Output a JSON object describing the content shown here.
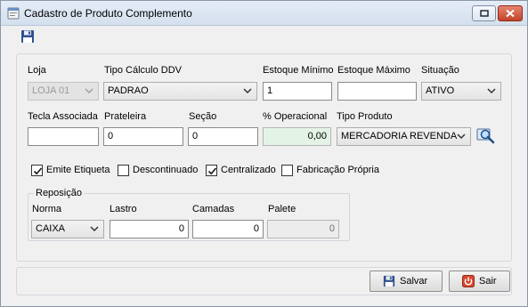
{
  "window": {
    "title": "Cadastro de Produto Complemento",
    "icons": {
      "app": "app-form-icon",
      "restore": "restore-icon",
      "close": "close-icon"
    }
  },
  "toolbar": {
    "save_icon": "floppy-disk-icon"
  },
  "form": {
    "loja": {
      "label": "Loja",
      "value": "LOJA 01"
    },
    "tipo_calculo_ddv": {
      "label": "Tipo Cálculo DDV",
      "value": "PADRAO"
    },
    "estoque_minimo": {
      "label": "Estoque Mínimo",
      "value": "1"
    },
    "estoque_maximo": {
      "label": "Estoque Máximo",
      "value": ""
    },
    "situacao": {
      "label": "Situação",
      "value": "ATIVO"
    },
    "tecla_associada": {
      "label": "Tecla Associada",
      "value": ""
    },
    "prateleira": {
      "label": "Prateleira",
      "value": "0"
    },
    "secao": {
      "label": "Seção",
      "value": "0"
    },
    "percentual_operacional": {
      "label": "% Operacional",
      "value": "0,00"
    },
    "tipo_produto": {
      "label": "Tipo Produto",
      "value": "MERCADORIA REVENDA",
      "search_icon": "search-magnifier-icon"
    }
  },
  "checkboxes": [
    {
      "label": "Emite Etiqueta",
      "checked": true
    },
    {
      "label": "Descontinuado",
      "checked": false
    },
    {
      "label": "Centralizado",
      "checked": true
    },
    {
      "label": "Fabricação Própria",
      "checked": false
    }
  ],
  "reposicao": {
    "title": "Reposição",
    "norma": {
      "label": "Norma",
      "value": "CAIXA"
    },
    "lastro": {
      "label": "Lastro",
      "value": "0"
    },
    "camadas": {
      "label": "Camadas",
      "value": "0"
    },
    "palete": {
      "label": "Palete",
      "value": "0"
    }
  },
  "buttons": {
    "save": {
      "label": "Salvar",
      "icon": "floppy-disk-icon"
    },
    "exit": {
      "label": "Sair",
      "icon": "power-exit-icon"
    }
  }
}
